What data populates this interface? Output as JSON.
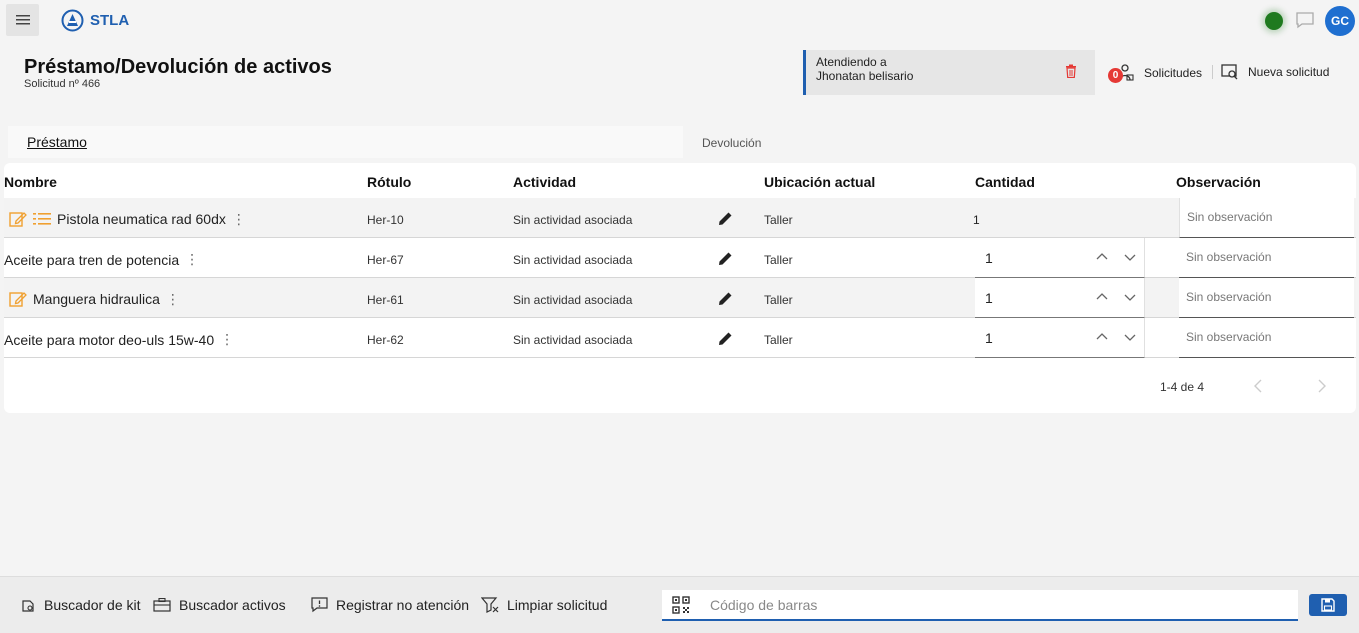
{
  "app": {
    "logo_text": "STLA"
  },
  "header": {
    "avatar_initials": "GC",
    "status_color": "#1f7a1f"
  },
  "page": {
    "title": "Préstamo/Devolución de activos",
    "subtitle": "Solicitud nº 466"
  },
  "attending": {
    "label": "Atendiendo a",
    "person": "Jhonatan belisario"
  },
  "actions": {
    "requests_label": "Solicitudes",
    "requests_count": "0",
    "new_request_label": "Nueva solicitud"
  },
  "tabs": [
    {
      "label": "Préstamo",
      "active": true
    },
    {
      "label": "Devolución",
      "active": false
    }
  ],
  "table": {
    "headers": {
      "name": "Nombre",
      "label": "Rótulo",
      "activity": "Actividad",
      "location": "Ubicación actual",
      "quantity": "Cantidad",
      "observation": "Observación"
    },
    "rows": [
      {
        "name": "Pistola neumatica rad 60dx",
        "label": "Her-10",
        "activity": "Sin actividad asociada",
        "location": "Taller",
        "quantity": "1",
        "observation_placeholder": "Sin observación",
        "icons": [
          "edit-note-icon",
          "list-icon"
        ]
      },
      {
        "name": "Aceite para tren de potencia",
        "label": "Her-67",
        "activity": "Sin actividad asociada",
        "location": "Taller",
        "quantity": "1",
        "observation_placeholder": "Sin observación",
        "icons": []
      },
      {
        "name": "Manguera hidraulica",
        "label": "Her-61",
        "activity": "Sin actividad asociada",
        "location": "Taller",
        "quantity": "1",
        "observation_placeholder": "Sin observación",
        "icons": [
          "edit-note-icon"
        ]
      },
      {
        "name": "Aceite para motor deo-uls 15w-40",
        "label": "Her-62",
        "activity": "Sin actividad asociada",
        "location": "Taller",
        "quantity": "1",
        "observation_placeholder": "Sin observación",
        "icons": []
      }
    ],
    "pagination": "1-4 de 4"
  },
  "footer": {
    "kit_search": "Buscador de kit",
    "asset_search": "Buscador activos",
    "register_no_attention": "Registrar no atención",
    "clear_request": "Limpiar solicitud",
    "barcode_placeholder": "Código de barras"
  },
  "colors": {
    "accent": "#1f5fb0",
    "warning_icon": "#f0a030",
    "badge": "#e53935"
  }
}
